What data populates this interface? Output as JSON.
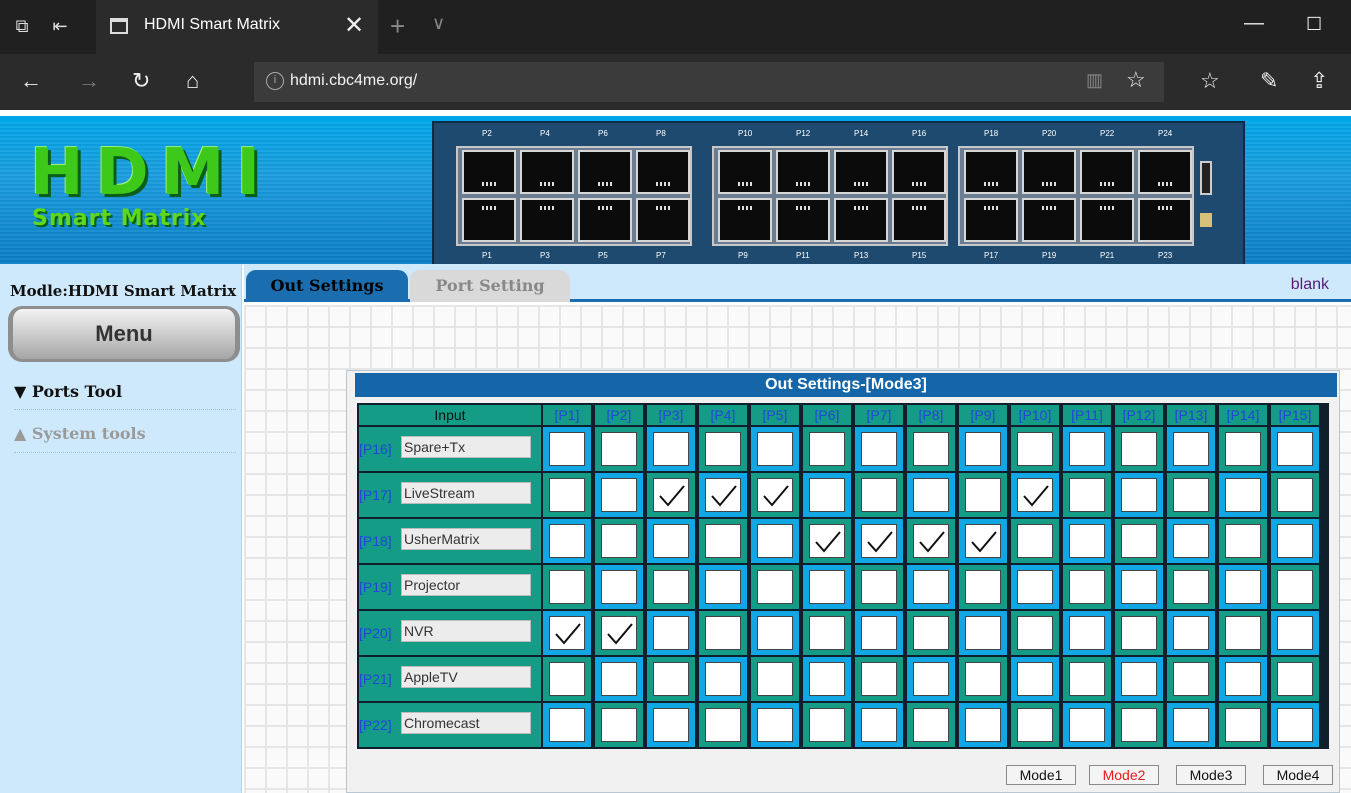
{
  "browser": {
    "tab_title": "HDMI Smart Matrix",
    "url": "hdmi.cbc4me.org/"
  },
  "banner": {
    "logo_main": "HDMI",
    "logo_sub": "Smart Matrix",
    "device_top_labels": [
      "P2",
      "P4",
      "P6",
      "P8",
      "P10",
      "P12",
      "P14",
      "P16",
      "P18",
      "P20",
      "P22",
      "P24"
    ],
    "device_bottom_labels": [
      "P1",
      "P3",
      "P5",
      "P7",
      "P9",
      "P11",
      "P13",
      "P15",
      "P17",
      "P19",
      "P21",
      "P23"
    ]
  },
  "sidebar": {
    "model": "Modle:HDMI Smart Matrix",
    "menu_label": "Menu",
    "items": [
      {
        "label": "▼ Ports Tool",
        "color": "#111111"
      },
      {
        "label": "▲ System tools",
        "color": "#9a9a9a"
      }
    ]
  },
  "tabs": {
    "active": "Out Settings",
    "inactive": "Port Setting",
    "blank_link": "blank"
  },
  "panel": {
    "title": "Out Settings-[Mode3]",
    "input_header": "Input",
    "outputs": [
      "[P1]",
      "[P2]",
      "[P3]",
      "[P4]",
      "[P5]",
      "[P6]",
      "[P7]",
      "[P8]",
      "[P9]",
      "[P10]",
      "[P11]",
      "[P12]",
      "[P13]",
      "[P14]",
      "[P15]"
    ],
    "rows": [
      {
        "port": "[P16]",
        "name": "Spare+Tx",
        "checked": []
      },
      {
        "port": "[P17]",
        "name": "LiveStream",
        "checked": [
          3,
          4,
          5,
          10
        ]
      },
      {
        "port": "[P18]",
        "name": "UsherMatrix",
        "checked": [
          6,
          7,
          8,
          9
        ]
      },
      {
        "port": "[P19]",
        "name": "Projector",
        "checked": []
      },
      {
        "port": "[P20]",
        "name": "NVR",
        "checked": [
          1,
          2
        ]
      },
      {
        "port": "[P21]",
        "name": "AppleTV",
        "checked": []
      },
      {
        "port": "[P22]",
        "name": "Chromecast",
        "checked": []
      }
    ],
    "modes": [
      {
        "label": "Mode1",
        "active": false
      },
      {
        "label": "Mode2",
        "active": true
      },
      {
        "label": "Mode3",
        "active": false
      },
      {
        "label": "Mode4",
        "active": false
      }
    ]
  },
  "colors": {
    "cell_green": "#149c86",
    "cell_blue": "#11a7e4",
    "header_text": "#2246d8",
    "active_mode": "#e81b1b",
    "title_bar": "#1566a8"
  }
}
